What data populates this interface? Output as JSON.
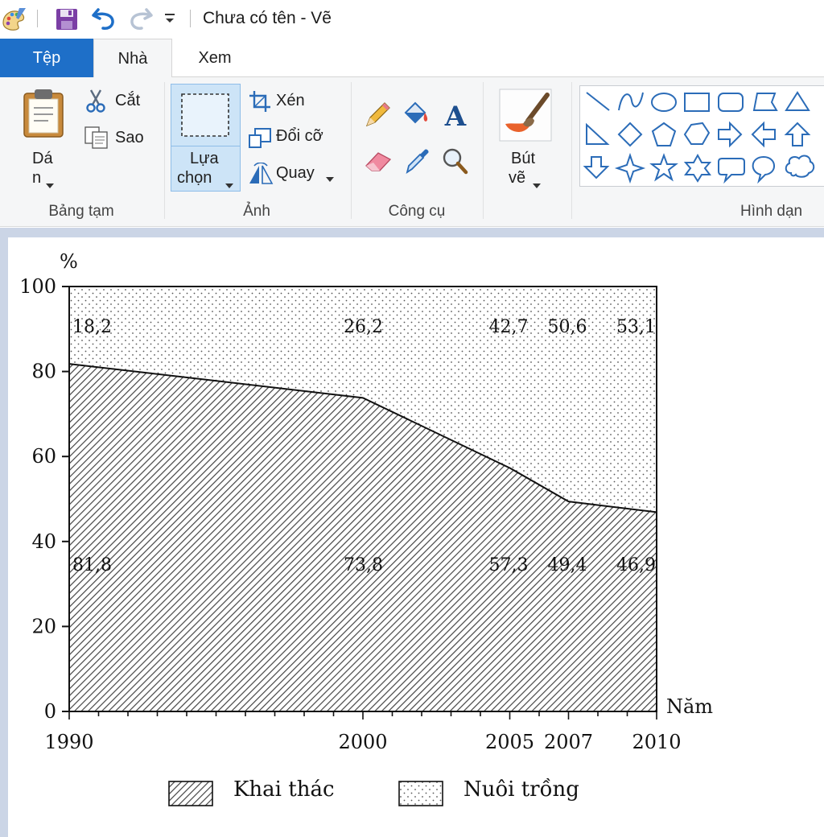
{
  "window": {
    "title": "Chưa có tên - Vẽ"
  },
  "tabs": [
    {
      "label": "Tệp"
    },
    {
      "label": "Nhà"
    },
    {
      "label": "Xem"
    }
  ],
  "ribbon": {
    "clipboard": {
      "label": "Bảng tạm",
      "paste_label_1": "Dá",
      "paste_label_2": "n",
      "cut_label": "Cắt",
      "copy_label": "Sao"
    },
    "image": {
      "label": "Ảnh",
      "select_label_1": "Lựa",
      "select_label_2": "chọn",
      "crop_label": "Xén",
      "resize_label": "Đổi cỡ",
      "rotate_label": "Quay"
    },
    "tools": {
      "label": "Công cụ"
    },
    "brushes": {
      "label_1": "Bút",
      "label_2": "vẽ"
    },
    "shapes": {
      "label": "Hình dạn"
    }
  },
  "colors": {
    "file_tab": "#1e6fc8",
    "ribbon_bg": "#f5f6f7",
    "canvas_bg": "#cbd5e6",
    "selection": "#cde4f7",
    "shape_stroke": "#2b6cb8"
  },
  "chart_data": {
    "type": "area",
    "ylabel": "%",
    "xlabel": "Năm",
    "ylim": [
      0,
      100
    ],
    "yticks": [
      "0",
      "20",
      "40",
      "60",
      "80",
      "100"
    ],
    "x": [
      1990,
      2000,
      2005,
      2007,
      2010
    ],
    "xticks": [
      "1990",
      "2000",
      "2005",
      "2007",
      "2010"
    ],
    "stacked": true,
    "series": [
      {
        "name": "Khai thác",
        "values": [
          81.8,
          73.8,
          57.3,
          49.4,
          46.9
        ],
        "labels": [
          "81,8",
          "73,8",
          "57,3",
          "49,4",
          "46,9"
        ],
        "pattern": "diagonal-hatch"
      },
      {
        "name": "Nuôi trồng",
        "values": [
          18.2,
          26.2,
          42.7,
          50.6,
          53.1
        ],
        "labels": [
          "18,2",
          "26,2",
          "42,7",
          "50,6",
          "53,1"
        ],
        "pattern": "dots"
      }
    ],
    "legend": "bottom"
  }
}
